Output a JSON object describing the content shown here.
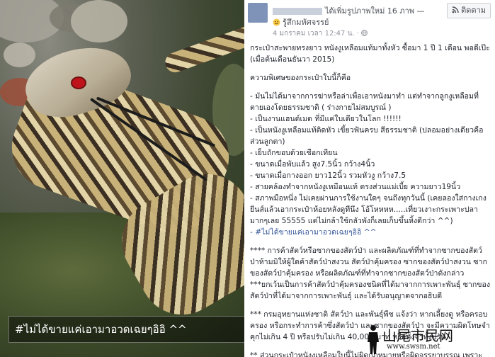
{
  "photo": {
    "caption": "#ไม่ได้ขายแค่เอามาอวดเฉยๆอิอิ ^^"
  },
  "post": {
    "author_action": "ได้เพิ่มรูปภาพใหม่ 16 ภาพ —",
    "follow_label": "ติดตาม",
    "feeling": "รู้สึกมหัศจรรย์",
    "timestamp": "4 มกราคม เวลา 12:47 น. ·",
    "paragraphs": [
      "กระเป๋าสะพายทรงยาว หนังงูเหลือมแท้มาทั้งหัว ซื้อมา 1 ปี 1 เดือน พอดีเป๊ะ (เมื่อต้นเดือนธันวา 2015)",
      "",
      "ความพิเศษของกระเป๋าใบนี้ก็คือ",
      "",
      "- มันไม่ได้มาจากการฆ่าหรือล่าเพื่อเอาหนังมาทำ แต่ทำจากลูกงูเหลือมที่ตายเองโดยธรรมชาติ ( ร่างกายไม่สมบูรณ์ )",
      "- เป็นงานแฮนด์เมด ที่มีแค่ใบเดียวในโลก !!!!!!",
      "- เป็นหนังงูเหลือมแท้ติดหัว เขี้ยวฟันครบ สีธรรมชาติ (ปลอมอย่างเดียวคือส่วนลูกตา)",
      "- เย็บถักขอบด้วยเชือกเทียน",
      "- ขนาดเมื่อพับแล้ว สูง7.5นิ้ว กว้าง4นิ้ว",
      "- ขนาดเมื่อกางออก ยาว12นิ้ว รวมหัวงู กว้าง7.5",
      "- สายคล้องทำจากหนังงูเหมือนแท้ ตรงส่วนแม่เบี้ย ความยาว19นิ้ว",
      "- สภาพมือหนึ่ง ไม่เคยผ่านการใช้งานใดๆ จนถึงทุกวันนี้ (เคยลองใส่กางเกงยีนส์แล้วเอากระเป๋าห้อยหลังดูทีนึง โอ้โหหหห.....เที่ยวเงาะกระเพาะปลามากๆเลย 55555 แต่ไม่กล้าใช้กลัวพังก็เลยเก็บขึ้นหิ้งดีกว่า ^^)",
      "- #ไม่ได้ขายแค่เอามาอวดเฉยๆอิอิ ^^",
      "",
      "**** การค้าสัตว์หรือซากของสัตว์ป่า และผลิตภัณฑ์ที่ทำจากซากของสัตว์ป่าห้ามมิให้ผู้ใดค้าสัตว์ป่าสงวน สัตว์ป่าคุ้มครอง ซากของสัตว์ป่าสงวน ซากของสัตว์ป่าคุ้มครอง หรือผลิตภัณฑ์ที่ทำจากซากของสัตว์ป่าดังกล่าว",
      "***ยกเว้นเป็นการค้าสัตว์ป่าคุ้มครองชนิดที่ได้มาจากการเพาะพันธุ์ ซากของสัตว์ป่าที่ได้มาจากการเพาะพันธุ์ และได้รับอนุญาตจากอธิบดี",
      "",
      "*** กรมอุทยานแห่งชาติ สัตว์ป่า และพันธุ์พืช แจ้งว่า หากเลี้ยงดู หรือครอบครอง หรือกระทำการค้าซึ่งสัตว์ป่า และซากของสัตว์ป่า จะมีความผิดโทษจำคุกไม่เกิน 4 ปี หรือปรับไม่เกิน 40,000 บาท หรือทั้งจำทั้งปรับ",
      "",
      "** ส่วนกระเป๋าหนังงูเหลือมใบนี้ไม่ผิดกฎหมายหรือผิดจรรยาบรรณ เพราะไม่ได้แปรรูปของสัตว์หรบ. ที่อนุญาตให้ค้าสัตว์ป่า ฯ"
    ]
  },
  "watermark": {
    "site_text": "山尾市民网",
    "url": "www.swsm.net"
  },
  "icons": {
    "follow": "rss-icon",
    "feeling": "smiley-icon",
    "privacy": "globe-icon"
  }
}
